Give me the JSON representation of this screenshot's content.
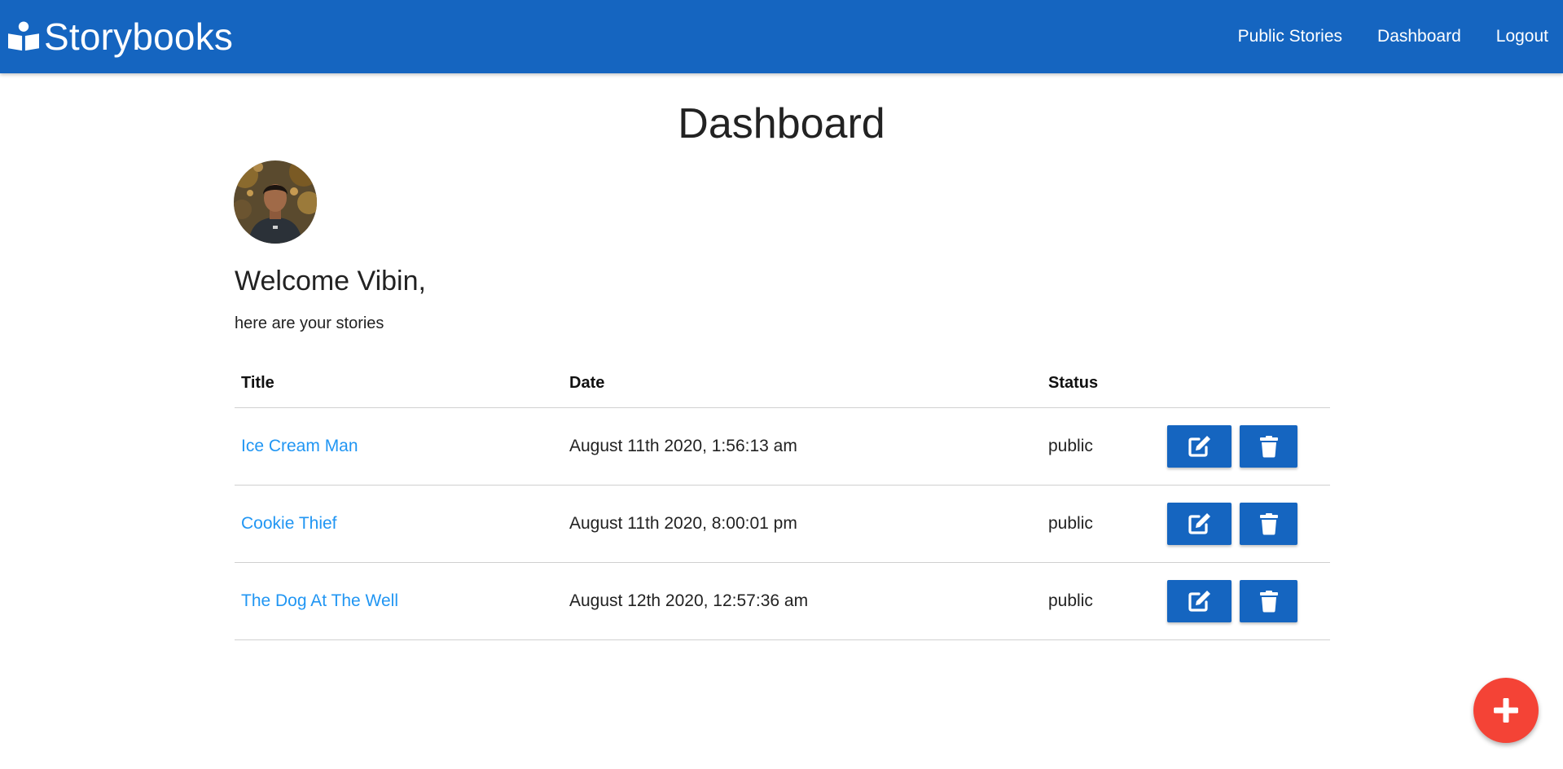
{
  "navbar": {
    "brand": "Storybooks",
    "brand_icon": "book-reader-icon",
    "bg_color": "#1565c0",
    "links": [
      {
        "label": "Public Stories"
      },
      {
        "label": "Dashboard"
      },
      {
        "label": "Logout"
      }
    ]
  },
  "page": {
    "title": "Dashboard",
    "welcome": "Welcome Vibin,",
    "subtitle": "here are your stories"
  },
  "table": {
    "headers": {
      "title": "Title",
      "date": "Date",
      "status": "Status"
    },
    "rows": [
      {
        "title": "Ice Cream Man",
        "date": "August 11th 2020, 1:56:13 am",
        "status": "public"
      },
      {
        "title": "Cookie Thief",
        "date": "August 11th 2020, 8:00:01 pm",
        "status": "public"
      },
      {
        "title": "The Dog At The Well",
        "date": "August 12th 2020, 12:57:36 am",
        "status": "public"
      }
    ],
    "row_actions": [
      "edit-icon",
      "trash-icon"
    ],
    "link_color": "#2196f3",
    "button_color": "#1565c0"
  },
  "fab": {
    "icon": "plus-icon",
    "color": "#f44336"
  }
}
